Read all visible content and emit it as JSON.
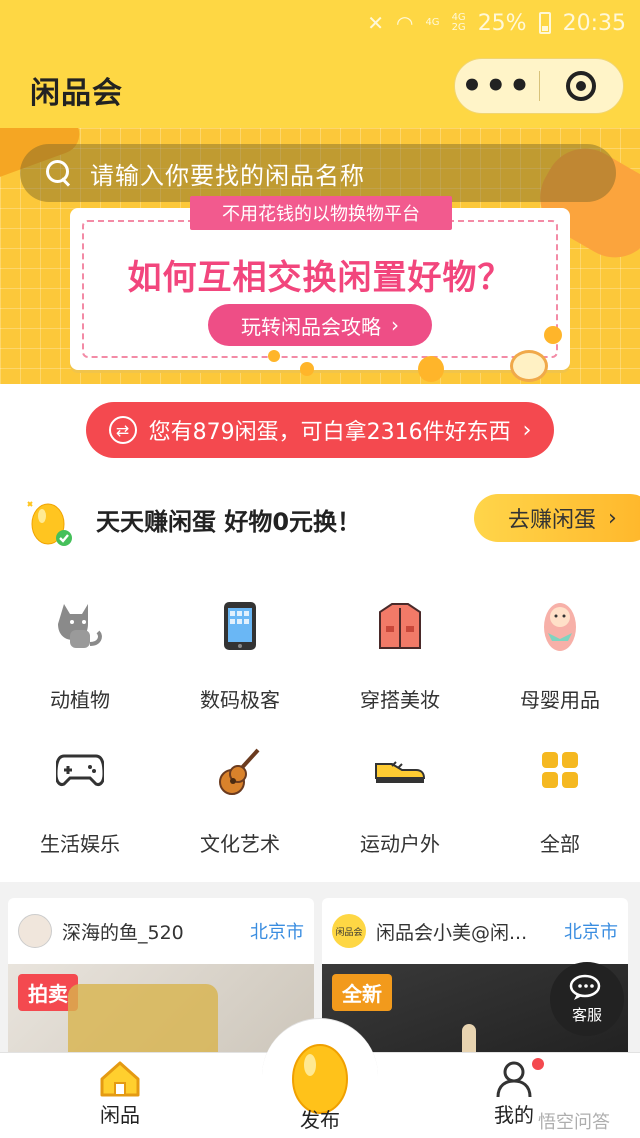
{
  "status_bar": {
    "signal_a": "4G",
    "signal_b": "4G",
    "signal_c": "2G",
    "battery": "25%",
    "time": "20:35"
  },
  "header": {
    "title": "闲品会",
    "more_label": "•••"
  },
  "banner": {
    "search_placeholder": "请输入你要找的闲品名称",
    "ribbon": "不用花钱的以物换物平台",
    "headline": "如何互相交换闲置好物？",
    "guide_button": "玩转闲品会攻略"
  },
  "egg_banner": {
    "text": "您有879闲蛋，可白拿2316件好东西",
    "swap_symbol": "⇄",
    "arrow": "›"
  },
  "earn": {
    "text": "天天赚闲蛋 好物0元换！",
    "button": "去赚闲蛋"
  },
  "categories": [
    {
      "label": "动植物",
      "icon": "cat-icon"
    },
    {
      "label": "数码极客",
      "icon": "phone-icon"
    },
    {
      "label": "穿搭美妆",
      "icon": "jacket-icon"
    },
    {
      "label": "母婴用品",
      "icon": "baby-icon"
    },
    {
      "label": "生活娱乐",
      "icon": "gamepad-icon"
    },
    {
      "label": "文化艺术",
      "icon": "guitar-icon"
    },
    {
      "label": "运动户外",
      "icon": "sneaker-icon"
    },
    {
      "label": "全部",
      "icon": "grid-icon"
    }
  ],
  "feed": [
    {
      "user": "深海的鱼_520",
      "city": "北京市",
      "tag": "拍卖"
    },
    {
      "avatar_text": "闲品会",
      "user": "闲品会小美@闲...",
      "city": "北京市",
      "tag": "全新"
    }
  ],
  "customer_service": {
    "label": "客服"
  },
  "tabbar": {
    "home": "闲品",
    "publish": "发布",
    "mine": "我的"
  },
  "watermark": "悟空问答",
  "colors": {
    "brand_yellow": "#fed744",
    "accent_red": "#f4494f",
    "accent_pink": "#f2467d",
    "link_blue": "#3a8de0"
  }
}
